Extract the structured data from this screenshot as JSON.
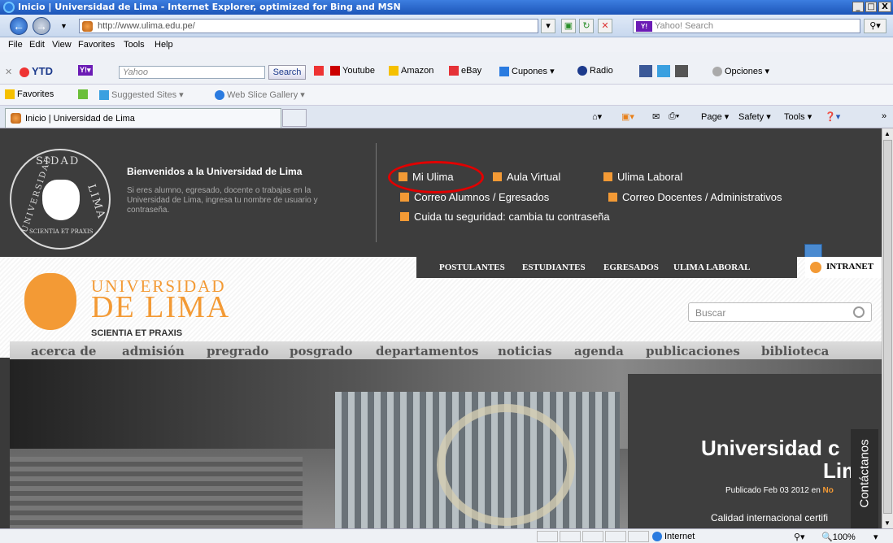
{
  "window": {
    "title": "Inicio | Universidad de Lima - Internet Explorer, optimized for Bing and MSN",
    "controls": [
      "_",
      "□",
      "X"
    ]
  },
  "address_bar": {
    "url": "http://www.ulima.edu.pe/"
  },
  "search_box": {
    "placeholder": "Yahoo! Search"
  },
  "menu": [
    "File",
    "Edit",
    "View",
    "Favorites",
    "Tools",
    "Help"
  ],
  "toolbar": {
    "ytd_label": "YTD",
    "yahoo_search_placeholder": "Yahoo",
    "search_button": "Search",
    "links": [
      "Youtube",
      "Amazon",
      "eBay",
      "Cupones ▾",
      "Radio",
      "Opciones ▾"
    ]
  },
  "favorites_bar": {
    "favorites_label": "Favorites",
    "suggested_sites": "Suggested Sites ▾",
    "web_slice": "Web Slice Gallery ▾"
  },
  "tab": {
    "title": "Inicio | Universidad de Lima"
  },
  "command_bar": {
    "page": "Page ▾",
    "safety": "Safety ▾",
    "tools": "Tools ▾",
    "help": "❓▾"
  },
  "site": {
    "seal_top_text": "SIDAD",
    "seal_left_text": "UNIVERSIDAD",
    "seal_right_text": "LIMA",
    "seal_bottom_text": "SCIENTIA ET PRAXIS",
    "welcome_title": "Bienvenidos a la Universidad de Lima",
    "welcome_text": "Si eres alumno, egresado, docente o trabajas en la Universidad de Lima, ingresa tu nombre de usuario y contraseña.",
    "quick_links": {
      "mi_ulima": "Mi Ulima",
      "aula_virtual": "Aula Virtual",
      "ulima_laboral": "Ulima Laboral",
      "correo_alumnos": "Correo Alumnos / Egresados",
      "correo_docentes": "Correo Docentes / Administrativos",
      "seguridad": "Cuida tu seguridad: cambia tu contraseña"
    },
    "top_nav": [
      "POSTULANTES",
      "ESTUDIANTES",
      "EGRESADOS",
      "ULIMA LABORAL"
    ],
    "intranet": "INTRANET",
    "brand_line1": "UNIVERSIDAD",
    "brand_line2": "DE LIMA",
    "brand_motto": "SCIENTIA ET PRAXIS",
    "search_placeholder": "Buscar",
    "main_nav": [
      "acerca de",
      "admisión",
      "pregrado",
      "posgrado",
      "departamentos",
      "noticias",
      "agenda",
      "publicaciones",
      "biblioteca"
    ],
    "hero": {
      "title_line1": "Universidad c",
      "title_line2": "Lim",
      "published_prefix": "Publicado Feb 03 2012 en",
      "published_cat": "No",
      "caption": "Calidad internacional certifi"
    },
    "contact_tab": "Contáctanos"
  },
  "status_bar": {
    "zone": "Internet",
    "zoom": "100%"
  }
}
